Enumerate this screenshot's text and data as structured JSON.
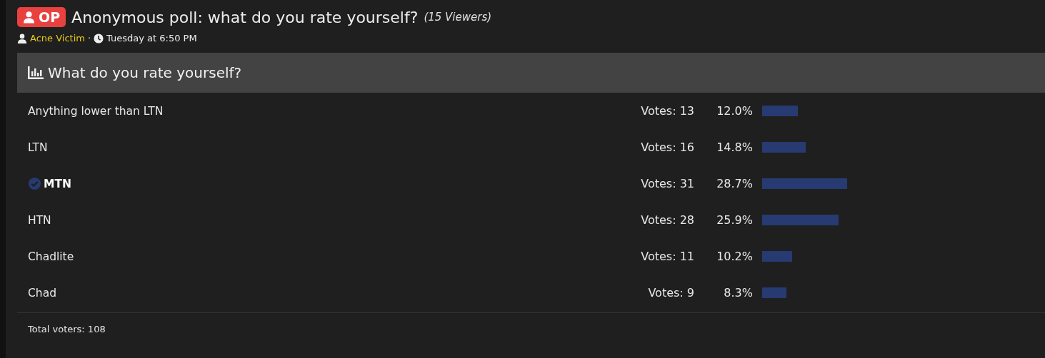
{
  "thread": {
    "badge": "OP",
    "title": "Anonymous poll: what do you rate yourself?",
    "viewers": "(15 Viewers)",
    "author": "Acne Victim",
    "separator": "·",
    "time": "Tuesday at 6:50 PM"
  },
  "poll": {
    "question": "What do you rate yourself?",
    "options": [
      {
        "label": "Anything lower than LTN",
        "selected": false,
        "votes": "Votes: 13",
        "percent": "12.0%"
      },
      {
        "label": "LTN",
        "selected": false,
        "votes": "Votes: 16",
        "percent": "14.8%"
      },
      {
        "label": "MTN",
        "selected": true,
        "votes": "Votes: 31",
        "percent": "28.7%"
      },
      {
        "label": "HTN",
        "selected": false,
        "votes": "Votes: 28",
        "percent": "25.9%"
      },
      {
        "label": "Chadlite",
        "selected": false,
        "votes": "Votes: 11",
        "percent": "10.2%"
      },
      {
        "label": "Chad",
        "selected": false,
        "votes": "Votes: 9",
        "percent": "8.3%"
      }
    ],
    "total": "Total voters: 108"
  }
}
